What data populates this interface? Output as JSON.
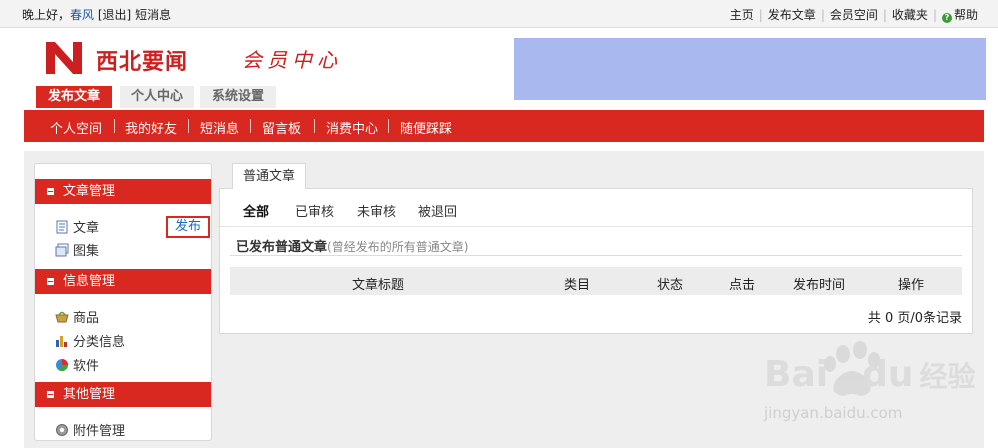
{
  "topbar": {
    "greeting": "晚上好，",
    "username": "春风",
    "logout": "[退出]",
    "messages": "短消息",
    "links": [
      "主页",
      "发布文章",
      "会员空间",
      "收藏夹"
    ],
    "help": "帮助"
  },
  "header": {
    "logo_text": "西北要闻",
    "member_center": "会员中心"
  },
  "main_tabs": [
    {
      "label": "发布文章",
      "active": true
    },
    {
      "label": "个人中心",
      "active": false
    },
    {
      "label": "系统设置",
      "active": false
    }
  ],
  "rednav": [
    "个人空间",
    "我的好友",
    "短消息",
    "留言板",
    "消费中心",
    "随便踩踩"
  ],
  "sidebar": {
    "sections": [
      {
        "title": "文章管理",
        "items": [
          {
            "label": "文章",
            "icon": "document-icon"
          },
          {
            "label": "图集",
            "icon": "gallery-icon"
          }
        ]
      },
      {
        "title": "信息管理",
        "items": [
          {
            "label": "商品",
            "icon": "basket-icon"
          },
          {
            "label": "分类信息",
            "icon": "bar-chart-icon"
          },
          {
            "label": "软件",
            "icon": "pie-icon"
          }
        ]
      },
      {
        "title": "其他管理",
        "items": [
          {
            "label": "附件管理",
            "icon": "gear-icon"
          }
        ]
      }
    ],
    "publish": "发布"
  },
  "panel": {
    "tab": "普通文章",
    "filters": [
      "全部",
      "已审核",
      "未审核",
      "被退回"
    ],
    "section_title": "已发布普通文章",
    "section_hint": "(曾经发布的所有普通文章)",
    "columns": [
      "文章标题",
      "类目",
      "状态",
      "点击",
      "发布时间",
      "操作"
    ],
    "footer": "共 0 页/0条记录"
  },
  "watermark": {
    "brand": "Bai",
    "brand2": "du",
    "cn": "经验",
    "url": "jingyan.baidu.com"
  },
  "colors": {
    "brand_red": "#d92820",
    "banner": "#a9b8ee",
    "link_blue": "#1a55a8"
  }
}
